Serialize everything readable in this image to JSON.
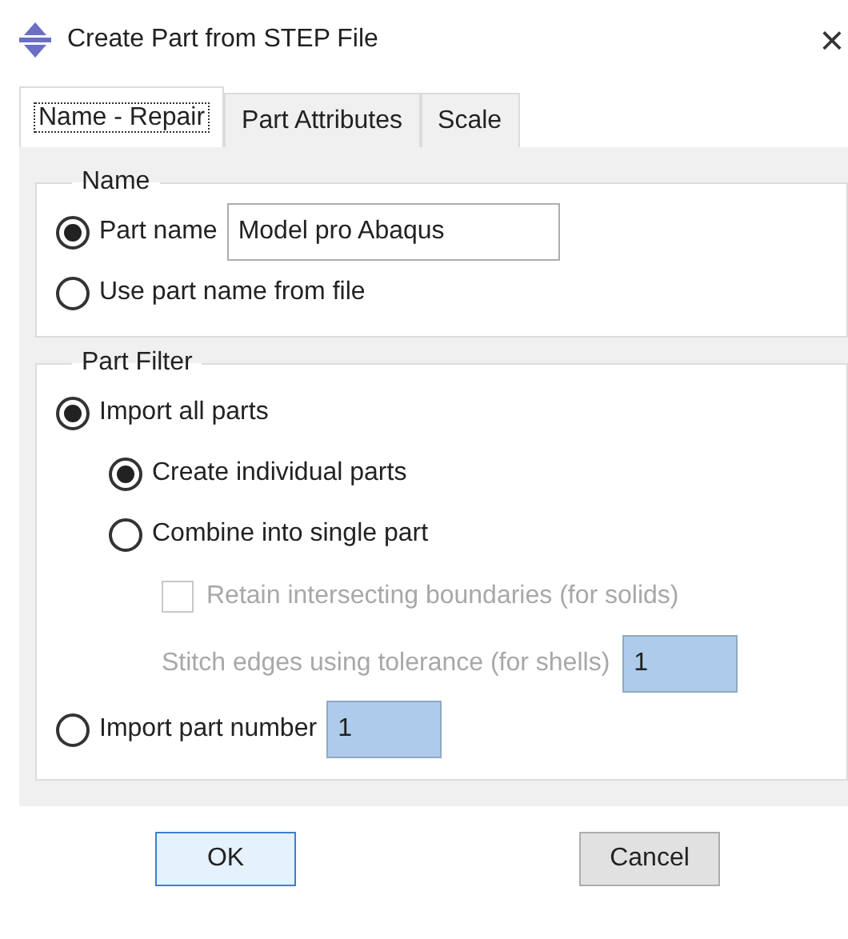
{
  "window": {
    "title": "Create Part from STEP File",
    "close": "×"
  },
  "tabs": [
    {
      "label": "Name - Repair",
      "selected": true
    },
    {
      "label": "Part Attributes",
      "selected": false
    },
    {
      "label": "Scale",
      "selected": false
    }
  ],
  "name_group": {
    "title": "Name",
    "options": [
      {
        "kind": "radio",
        "label": "Part name",
        "selected": true,
        "value": "Model pro Abaqus"
      },
      {
        "kind": "radio",
        "label": "Use part name from file",
        "selected": false
      }
    ]
  },
  "part_filter": {
    "title": "Part Filter",
    "options": [
      {
        "kind": "radio",
        "label": "Import all parts",
        "selected": true,
        "children": [
          {
            "kind": "radio",
            "label": "Create individual parts",
            "selected": true
          },
          {
            "kind": "radio",
            "label": "Combine into single part",
            "selected": false,
            "children": [
              {
                "kind": "checkbox",
                "label": "Retain intersecting boundaries (for solids)",
                "checked": false,
                "disabled": true
              },
              {
                "kind": "input",
                "label": "Stitch edges using tolerance (for shells)",
                "value": "1",
                "disabled": true
              }
            ]
          }
        ]
      },
      {
        "kind": "radio",
        "label": "Import part number",
        "selected": false,
        "value": "1"
      }
    ]
  },
  "buttons": [
    {
      "label": "OK",
      "default": true
    },
    {
      "label": "Cancel",
      "default": false
    }
  ]
}
